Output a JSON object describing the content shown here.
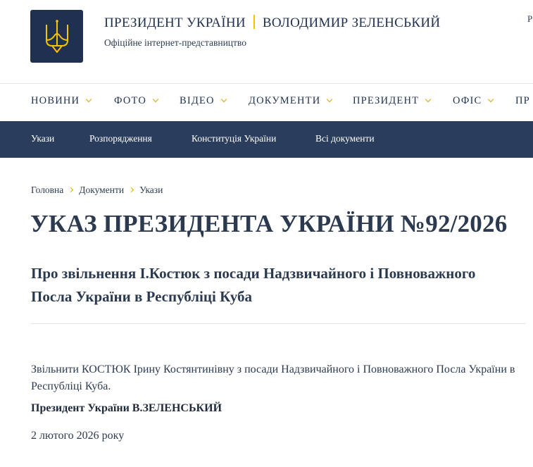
{
  "header": {
    "title_left": "ПРЕЗИДЕНТ УКРАЇНИ",
    "title_right": "ВОЛОДИМИР ЗЕЛЕНСЬКИЙ",
    "subtitle": "Офіційне інтернет-представництво",
    "lang_partial": "Р",
    "logo_icon": "trident-icon"
  },
  "main_nav": {
    "items": [
      {
        "label": "НОВИНИ"
      },
      {
        "label": "ФОТО"
      },
      {
        "label": "ВІДЕО"
      },
      {
        "label": "ДОКУМЕНТИ"
      },
      {
        "label": "ПРЕЗИДЕНТ"
      },
      {
        "label": "ОФІС"
      },
      {
        "label": "ПР"
      }
    ]
  },
  "sub_nav": {
    "items": [
      {
        "label": "Укази"
      },
      {
        "label": "Розпорядження"
      },
      {
        "label": "Конституція України"
      },
      {
        "label": "Всі документи"
      }
    ]
  },
  "breadcrumb": {
    "items": [
      "Головна",
      "Документи",
      "Укази"
    ]
  },
  "document": {
    "title": "УКАЗ ПРЕЗИДЕНТА УКРАЇНИ №92/2026",
    "subtitle": "Про звільнення І.Костюк з посади Надзвичайного і Повноважного Посла України в Республіці Куба",
    "text": "Звільнити КОСТЮК Ірину Костянтинівну з посади Надзвичайного і Повноважного Посла України в Республіці Куба.",
    "signature": "Президент України В.ЗЕЛЕНСЬКИЙ",
    "date": "2 лютого 2026 року"
  },
  "colors": {
    "navy": "#1f3050",
    "subnav_bg": "#2b3d5c",
    "accent_gold": "#f5c400",
    "text": "#2b3a4f"
  }
}
